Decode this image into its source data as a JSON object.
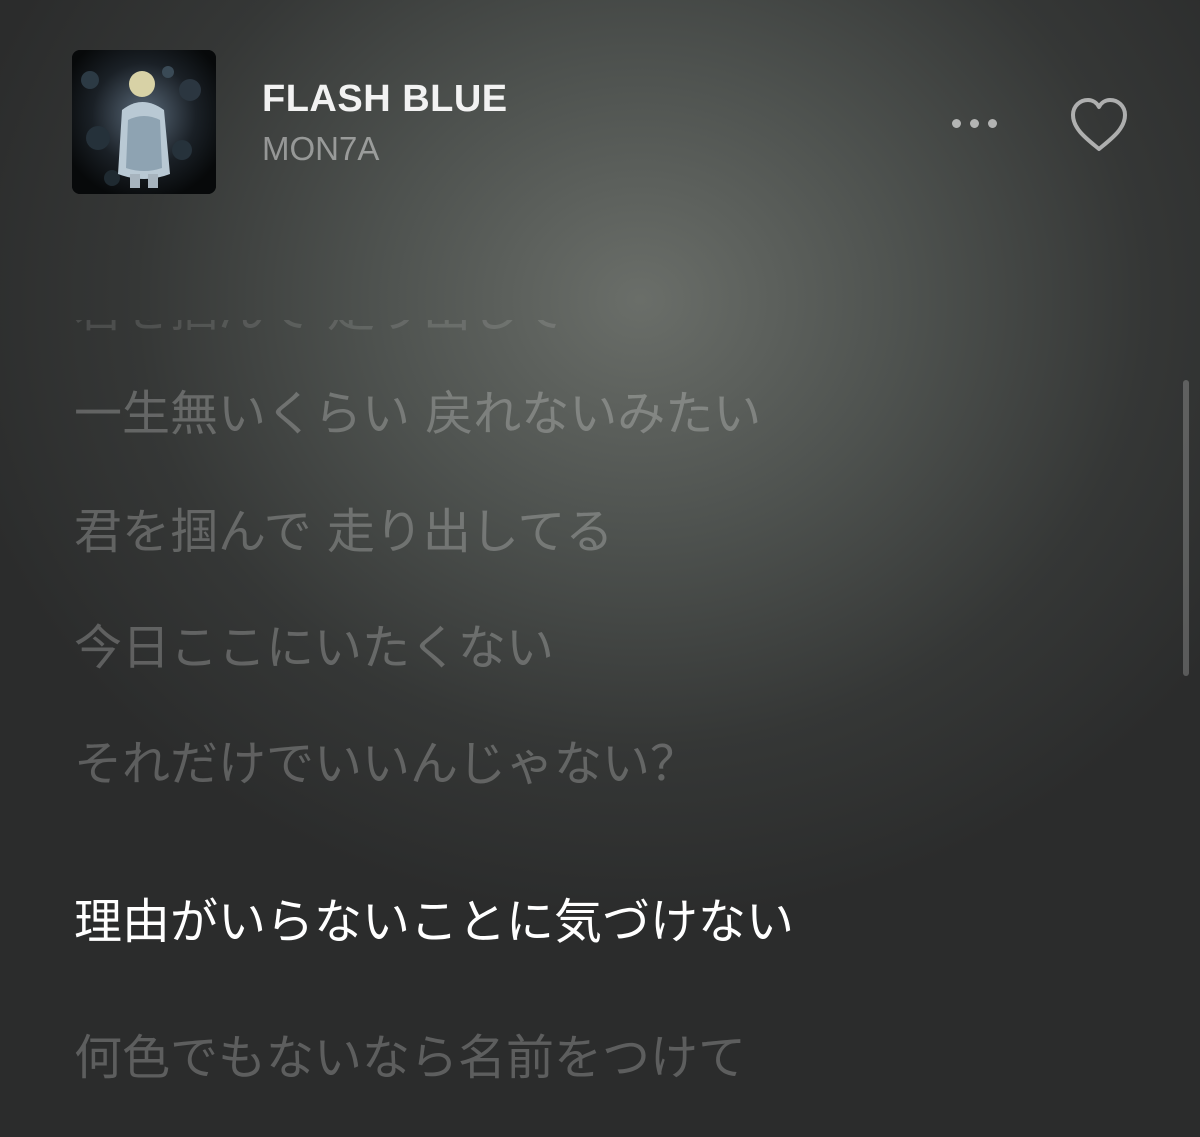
{
  "track": {
    "title": "FLASH BLUE",
    "artist": "MON7A"
  },
  "icons": {
    "more": "more-horizontal-icon",
    "love": "heart-outline-icon"
  },
  "lyrics": [
    {
      "text": "君を掴んで 走り出して",
      "state": "faded"
    },
    {
      "text": "一生無いくらい 戻れないみたい",
      "state": "inactive"
    },
    {
      "text": "君を掴んで 走り出してる",
      "state": "inactive"
    },
    {
      "text": "今日ここにいたくない",
      "state": "inactive"
    },
    {
      "text": "それだけでいいんじゃない？",
      "state": "inactive"
    },
    {
      "text": "理由がいらないことに気づけない",
      "state": "active"
    },
    {
      "text": "何色でもないなら名前をつけて",
      "state": "inactive"
    }
  ],
  "colors": {
    "active_lyric": "#ffffff",
    "inactive_lyric": "rgba(255,255,255,0.24)",
    "background": "#4e524f"
  }
}
